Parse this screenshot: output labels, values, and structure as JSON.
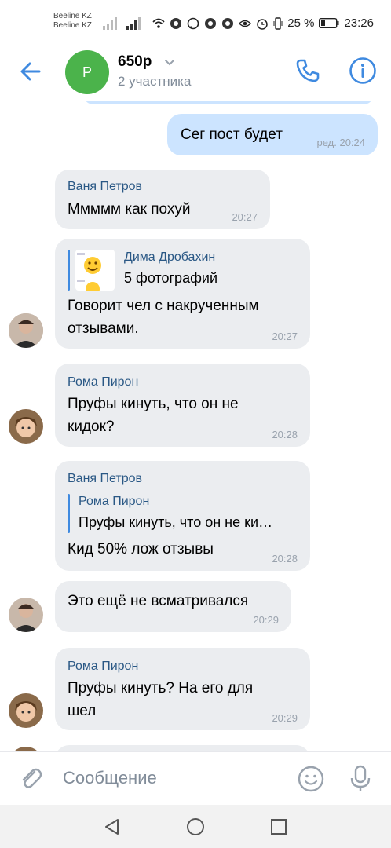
{
  "status": {
    "carrier1": "Beeline KZ",
    "carrier2": "Beeline KZ",
    "battery": "25 %",
    "time": "23:26"
  },
  "header": {
    "avatar_letter": "Р",
    "title": "650р",
    "subtitle": "2 участника"
  },
  "messages": {
    "m1": {
      "text": "Сег пост будет",
      "time": "ред. 20:24"
    },
    "m2": {
      "sender": "Ваня Петров",
      "text": "Ммммм как похуй",
      "time": "20:27"
    },
    "m3": {
      "fwd_name": "Дима Дробахин",
      "fwd_text": "5 фотографий",
      "text1": "Говорит чел с накрученным",
      "text2": "отзывами.",
      "time": "20:27"
    },
    "m4": {
      "sender": "Рома Пирон",
      "text1": "Пруфы кинуть, что он не",
      "text2": "кидок?",
      "time": "20:28"
    },
    "m5": {
      "sender": "Ваня Петров",
      "reply_name": "Рома Пирон",
      "reply_text": "Пруфы кинуть, что он не ки…",
      "text": "Кид 50% лож отзывы",
      "time": "20:28"
    },
    "m6": {
      "text": "Это ещё не всматривался",
      "time": "20:29"
    },
    "m7": {
      "sender": "Рома Пирон",
      "text1": "Пруфы кинуть? На его для",
      "text2": "шел",
      "time": "20:29"
    }
  },
  "input": {
    "placeholder": "Сообщение"
  },
  "colors": {
    "accent": "#3f8ae0",
    "incoming": "#ebedf0",
    "outgoing": "#cce4ff",
    "name": "#2a5885"
  }
}
